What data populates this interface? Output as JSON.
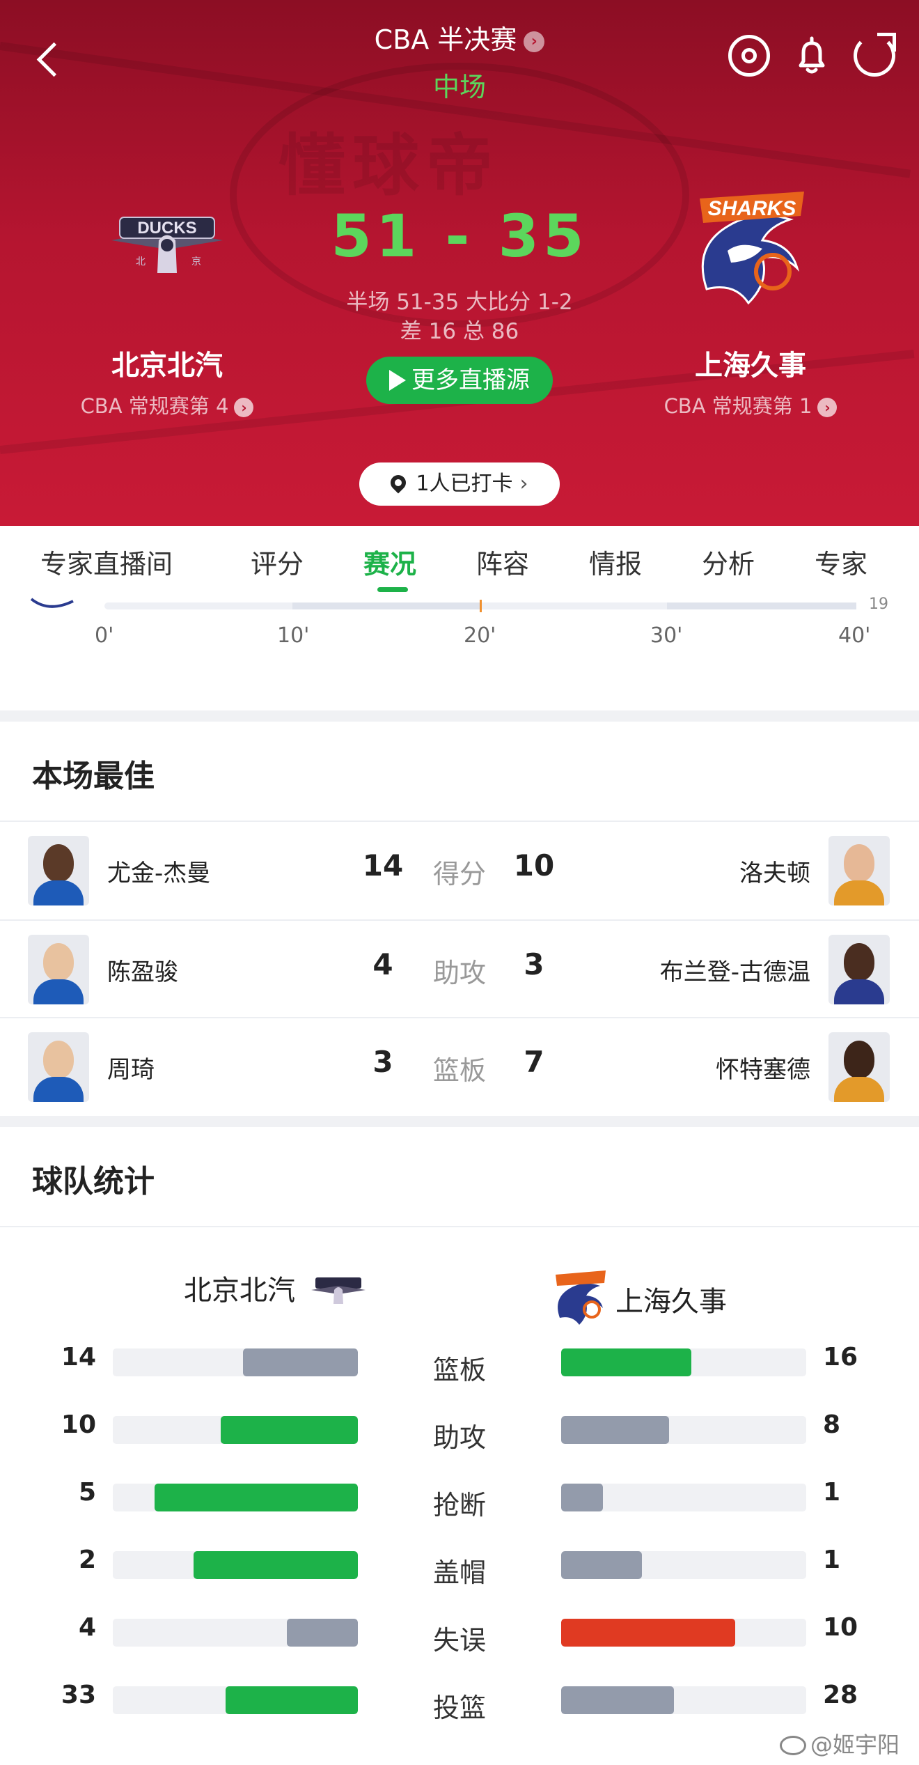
{
  "header": {
    "league": "CBA 半决赛",
    "status": "中场",
    "watermark": "懂球帝",
    "score": "51 - 35",
    "halftime": "半场 51-35 大比分 1-2",
    "diff_total": "差 16 总 86",
    "more_live": "更多直播源",
    "checkin": "1人已打卡",
    "home": {
      "name": "北京北汽",
      "rank": "CBA 常规赛第 4",
      "logo_text": "DUCKS"
    },
    "away": {
      "name": "上海久事",
      "rank": "CBA 常规赛第 1",
      "logo_text": "SHARKS"
    }
  },
  "tabs": [
    "专家直播间",
    "评分",
    "赛况",
    "阵容",
    "情报",
    "分析",
    "专家"
  ],
  "active_tab": "赛况",
  "timeline": {
    "ticks": [
      "0'",
      "10'",
      "20'",
      "30'",
      "40'"
    ],
    "right_value": "19"
  },
  "best": {
    "title": "本场最佳",
    "rows": [
      {
        "home_player": "尤金-杰曼",
        "home_value": "14",
        "category": "得分",
        "away_value": "10",
        "away_player": "洛夫顿"
      },
      {
        "home_player": "陈盈骏",
        "home_value": "4",
        "category": "助攻",
        "away_value": "3",
        "away_player": "布兰登-古德温"
      },
      {
        "home_player": "周琦",
        "home_value": "3",
        "category": "篮板",
        "away_value": "7",
        "away_player": "怀特塞德"
      }
    ]
  },
  "team_stats": {
    "title": "球队统计",
    "home_team": "北京北汽",
    "away_team": "上海久事",
    "rows": [
      {
        "category": "篮板",
        "home": 14,
        "away": 16,
        "home_fill": 0.47,
        "away_fill": 0.53,
        "home_color": "#939bab",
        "away_color": "#1db249"
      },
      {
        "category": "助攻",
        "home": 10,
        "away": 8,
        "home_fill": 0.56,
        "away_fill": 0.44,
        "home_color": "#1db249",
        "away_color": "#939bab"
      },
      {
        "category": "抢断",
        "home": 5,
        "away": 1,
        "home_fill": 0.83,
        "away_fill": 0.17,
        "home_color": "#1db249",
        "away_color": "#939bab"
      },
      {
        "category": "盖帽",
        "home": 2,
        "away": 1,
        "home_fill": 0.67,
        "away_fill": 0.33,
        "home_color": "#1db249",
        "away_color": "#939bab"
      },
      {
        "category": "失误",
        "home": 4,
        "away": 10,
        "home_fill": 0.29,
        "away_fill": 0.71,
        "home_color": "#939bab",
        "away_color": "#e03a22"
      },
      {
        "category": "投篮",
        "home": 33,
        "away": 28,
        "home_fill": 0.54,
        "away_fill": 0.46,
        "home_color": "#1db249",
        "away_color": "#939bab"
      }
    ]
  },
  "watermark_credit": "@姬宇阳",
  "colors": {
    "hero": "#b51530",
    "accent_green": "#1db249",
    "score_green": "#5cd65c",
    "bar_gray": "#939bab",
    "bar_red": "#e03a22"
  }
}
